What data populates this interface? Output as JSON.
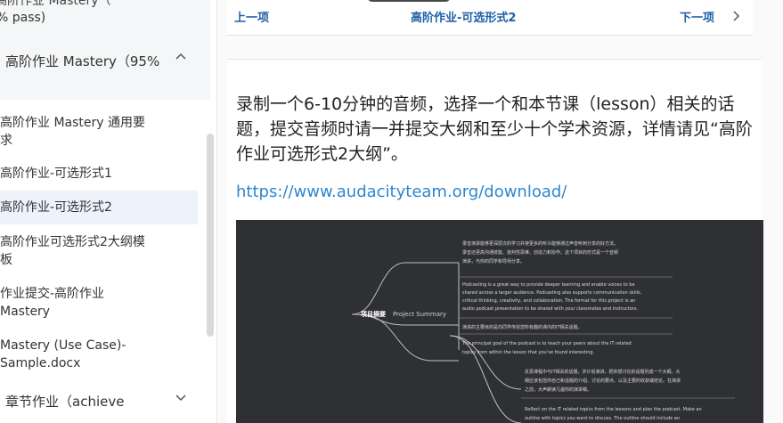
{
  "sidebar": {
    "cut_line": "高阶作业 Mastery（",
    "pass_line": "% pass)",
    "group_title": "高阶作业 Mastery（95%",
    "items": [
      {
        "lines": [
          "高阶作业 Mastery 通用要",
          "求"
        ]
      },
      {
        "lines": [
          "高阶作业-可选形式1"
        ]
      },
      {
        "lines": [
          "高阶作业-可选形式2"
        ]
      },
      {
        "lines": [
          "高阶作业可选形式2大纲模",
          "板"
        ]
      },
      {
        "lines": [
          "作业提交-高阶作业",
          "Mastery"
        ]
      },
      {
        "lines": [
          "Mastery (Use Case)-",
          "Sample.docx"
        ]
      }
    ],
    "bottom_group": "章节作业（achieve"
  },
  "topbar": {
    "prev_label": "上一项",
    "title": "高阶作业-可选形式2",
    "next_label": "下一项"
  },
  "content": {
    "description": "录制一个6-10分钟的音频，选择一个和本节课（lesson）相关的话题，提交音频时请一并提交大纲和至少十个学术资源，详情请见“高阶作业可选形式2大纲”。",
    "link": "https://www.audacityteam.org/download/"
  },
  "mindmap": {
    "root_cn": "项目摘要",
    "root_en": "Project Summary",
    "block1_cn": [
      "录音演讲能够更深层次的学习并使更多的听众能够通过声音听到分享的好方法。",
      "录音还更高沟通技能、批判性思维、创造力和协作。这个项目的形式是一个音频",
      "演讲，与你的同学和导师分享。"
    ],
    "block1_en": [
      "Podcasting is a great way to provide deeper learning and enable voices to be",
      "shared across a larger audience. Podcasting also supports communication skills,",
      "critical thinking, creativity, and collaboration. The format for this project is an",
      "audio podcast presentation to be shared with your classmates and instructors."
    ],
    "block2_cn": [
      "演讲的主要目的是向同学传授您所有趣的课内的IT相关话题。"
    ],
    "block2_en": [
      "The principal goal of the podcast is to teach your peers about the IT related",
      "topics from within the lesson that you've found interesting."
    ],
    "block3_cn": [
      "反思课程中与IT相关的话题，并计划演讲。把你想讨论的话题列成一个大纲。大",
      "纲应该包括你自己和话题的介绍、讨论的要点、以及主要的收获或结论。在演讲",
      "之前，大声朗读几遍你的演讲稿。"
    ],
    "block3_en": [
      "Reflect on the IT related topics from the lessons and plan the podcast. Make an",
      "outline with topics you want to discuss. The outline should include an"
    ]
  }
}
